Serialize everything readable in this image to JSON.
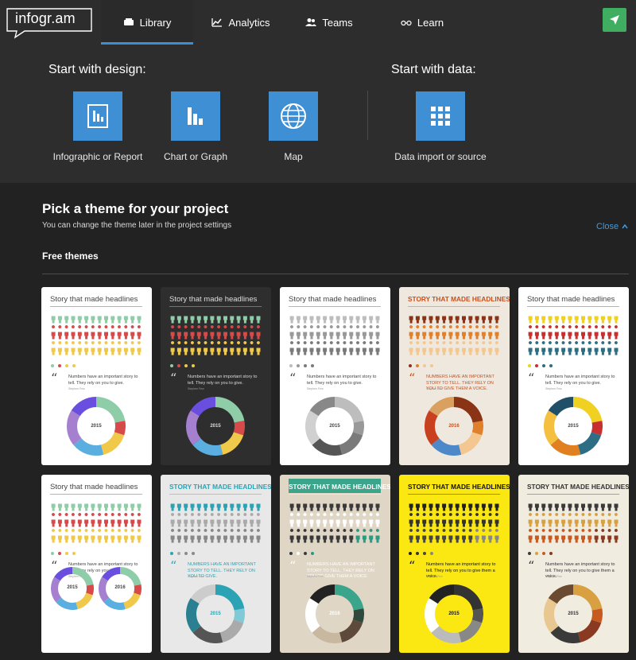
{
  "nav": {
    "logo": "infogr.am",
    "items": [
      {
        "label": "Library",
        "icon": "library-icon",
        "active": true
      },
      {
        "label": "Analytics",
        "icon": "chart-line-icon",
        "active": false
      },
      {
        "label": "Teams",
        "icon": "people-icon",
        "active": false
      },
      {
        "label": "Learn",
        "icon": "glasses-icon",
        "active": false
      }
    ],
    "launch_icon": "paper-plane-icon"
  },
  "start": {
    "design_heading": "Start with design:",
    "data_heading": "Start with data:",
    "options": [
      {
        "label": "Infographic or Report",
        "icon": "report-icon"
      },
      {
        "label": "Chart or Graph",
        "icon": "bar-chart-icon"
      },
      {
        "label": "Map",
        "icon": "globe-icon"
      },
      {
        "label": "Data import or source",
        "icon": "grid-icon"
      }
    ]
  },
  "themes": {
    "title": "Pick a theme for your project",
    "subtitle": "You can change the theme later in the project settings",
    "close_label": "Close",
    "free_label": "Free themes",
    "cards": [
      {
        "title": "Story that made headlines",
        "quote": "Numbers have an important story to tell. They rely on you to give.",
        "author": "Stephen Few",
        "year": "2015",
        "bg": "#ffffff",
        "fg": "#444444",
        "rows": [
          "#8fcca8",
          "#d64a4a",
          "#f0c94a",
          "#f0c94a"
        ],
        "donut": [
          "#8fcca8",
          "#d64a4a",
          "#f0c94a",
          "#5aaee0",
          "#a480cf",
          "#6a4ee0"
        ]
      },
      {
        "title": "Story that made headlines",
        "quote": "Numbers have an important story to tell. They rely on you to give.",
        "author": "Stephen Few",
        "year": "2015",
        "bg": "#2e2e2e",
        "fg": "#dddddd",
        "rows": [
          "#8fcca8",
          "#d64a4a",
          "#f0c94a",
          "#f0c94a"
        ],
        "donut": [
          "#8fcca8",
          "#d64a4a",
          "#f0c94a",
          "#5aaee0",
          "#a480cf",
          "#6a4ee0"
        ]
      },
      {
        "title": "Story that made headlines",
        "quote": "Numbers have an important story to tell. They rely on you to give.",
        "author": "Stephen Few",
        "year": "2015",
        "bg": "#ffffff",
        "fg": "#444444",
        "rows": [
          "#bdbdbd",
          "#999999",
          "#7a7a7a",
          "#7a7a7a"
        ],
        "donut": [
          "#bdbdbd",
          "#999999",
          "#7a7a7a",
          "#555555",
          "#d0d0d0",
          "#888888"
        ]
      },
      {
        "title": "STORY THAT MADE HEADLINES",
        "quote": "NUMBERS HAVE AN IMPORTANT STORY TO TELL. THEY RELY ON YOU TO GIVE THEM A VOICE.",
        "author": "Stephen Few",
        "year": "2016",
        "bg": "#efe8df",
        "fg": "#c8501c",
        "rows": [
          "#8a3315",
          "#e0802a",
          "#f3c78f",
          "#f3c78f"
        ],
        "donut": [
          "#8a3315",
          "#e0802a",
          "#f3c78f",
          "#4d88c8",
          "#c84020",
          "#d9a060"
        ]
      },
      {
        "title": "Story that made headlines",
        "quote": "Numbers have an important story to tell. They rely on you to give.",
        "author": "Stephen Few",
        "year": "2015",
        "bg": "#ffffff",
        "fg": "#444444",
        "rows": [
          "#f0d020",
          "#c83030",
          "#2e6e85",
          "#2e6e85"
        ],
        "donut": [
          "#f0d020",
          "#c83030",
          "#2e6e85",
          "#e08020",
          "#f5c040",
          "#1f5068"
        ]
      },
      {
        "title": "Story that made headlines",
        "quote": "Numbers have an important story to tell. They rely on you to give.",
        "author": "Stephen Few",
        "year": "2015",
        "bg": "#ffffff",
        "fg": "#444444",
        "rows": [
          "#8fcca8",
          "#d64a4a",
          "#f0c94a",
          "#f0c94a"
        ],
        "donut": [
          "#8fcca8",
          "#d64a4a",
          "#f0c94a",
          "#5aaee0",
          "#a480cf",
          "#6a4ee0"
        ],
        "dual": true,
        "year2": "2016"
      },
      {
        "title": "STORY THAT MADE HEADLINES",
        "quote": "NUMBERS HAVE AN IMPORTANT STORY TO TELL. THEY RELY ON YOU TO GIVE.",
        "author": "Stephen Few",
        "year": "2015",
        "bg": "#e8e8e8",
        "fg": "#2ba3b4",
        "rows": [
          "#2ba3b4",
          "#aaaaaa",
          "#888888",
          "#888888"
        ],
        "donut": [
          "#2ba3b4",
          "#7fcad6",
          "#aaaaaa",
          "#555555",
          "#2a8090",
          "#cccccc"
        ]
      },
      {
        "title": "STORY THAT MADE HEADLINES",
        "quote": "NUMBERS HAVE AN IMPORTANT STORY TO TELL. THEY RELY ON YOU TO GIVE THEM A VOICE",
        "author": "Stephen Few",
        "year": "2016",
        "bg": "#e0d6c6",
        "fg": "#ffffff",
        "rows": [
          "#3a3a3a",
          "#ffffff",
          "#3a3a3a",
          "#2a9a80"
        ],
        "donut": [
          "#3aa58a",
          "#2f4a3c",
          "#5e4a3a",
          "#c8b8a0",
          "#ffffff",
          "#222222"
        ],
        "banner": "#3aa58a"
      },
      {
        "title": "STORY THAT MADE HEADLINES",
        "quote": "Numbers have an important story to tell. They rely on you to give them a voice.",
        "author": "Stephen Few",
        "year": "2015",
        "bg": "#fbe812",
        "fg": "#111111",
        "rows": [
          "#222222",
          "#333333",
          "#444444",
          "#888888"
        ],
        "donut": [
          "#333333",
          "#555555",
          "#888888",
          "#bbbbbb",
          "#ffffff",
          "#222222"
        ]
      },
      {
        "title": "STORY THAT MADE HEADLINES",
        "quote": "Numbers have an important story to tell. They rely on you to give them a voice.",
        "author": "Stephen Few",
        "year": "2015",
        "bg": "#f1ece0",
        "fg": "#333333",
        "rows": [
          "#3a3a3a",
          "#d8a040",
          "#c85a20",
          "#8a3a20"
        ],
        "donut": [
          "#d8a040",
          "#c85a20",
          "#8a3a20",
          "#3a3a3a",
          "#e8c890",
          "#6a4a30"
        ]
      }
    ]
  }
}
